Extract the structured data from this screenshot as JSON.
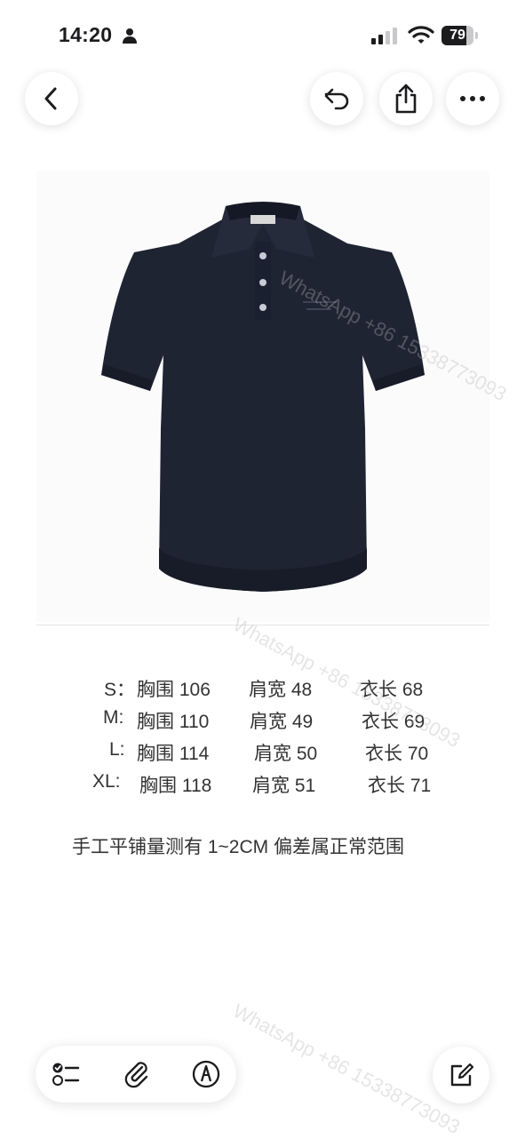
{
  "status_bar": {
    "time": "14:20",
    "battery": "79",
    "battery_level": 0.79
  },
  "size_table": [
    {
      "size": "S：",
      "chest": "胸围 106",
      "shoulder": "肩宽 48",
      "length": "衣长 68"
    },
    {
      "size": "M:",
      "chest": "胸围 110",
      "shoulder": "肩宽 49",
      "length": "衣长 69"
    },
    {
      "size": "L:",
      "chest": "胸围 114",
      "shoulder": "肩宽 50",
      "length": "衣长 70"
    },
    {
      "size": "XL:",
      "chest": "胸围 118",
      "shoulder": "肩宽 51",
      "length": "衣长 71"
    }
  ],
  "note": "手工平铺量测有 1~2CM 偏差属正常范围",
  "watermark": "WhatsApp +86 15338773093",
  "icons": {
    "back": "chevron-left-icon",
    "undo": "undo-icon",
    "share": "share-icon",
    "more": "ellipsis-icon",
    "checklist": "checklist-icon",
    "attach": "paperclip-icon",
    "markup": "markup-pen-icon",
    "compose": "compose-icon"
  },
  "colors": {
    "shirt": "#1f2433",
    "accent": "#1c1c1e"
  }
}
